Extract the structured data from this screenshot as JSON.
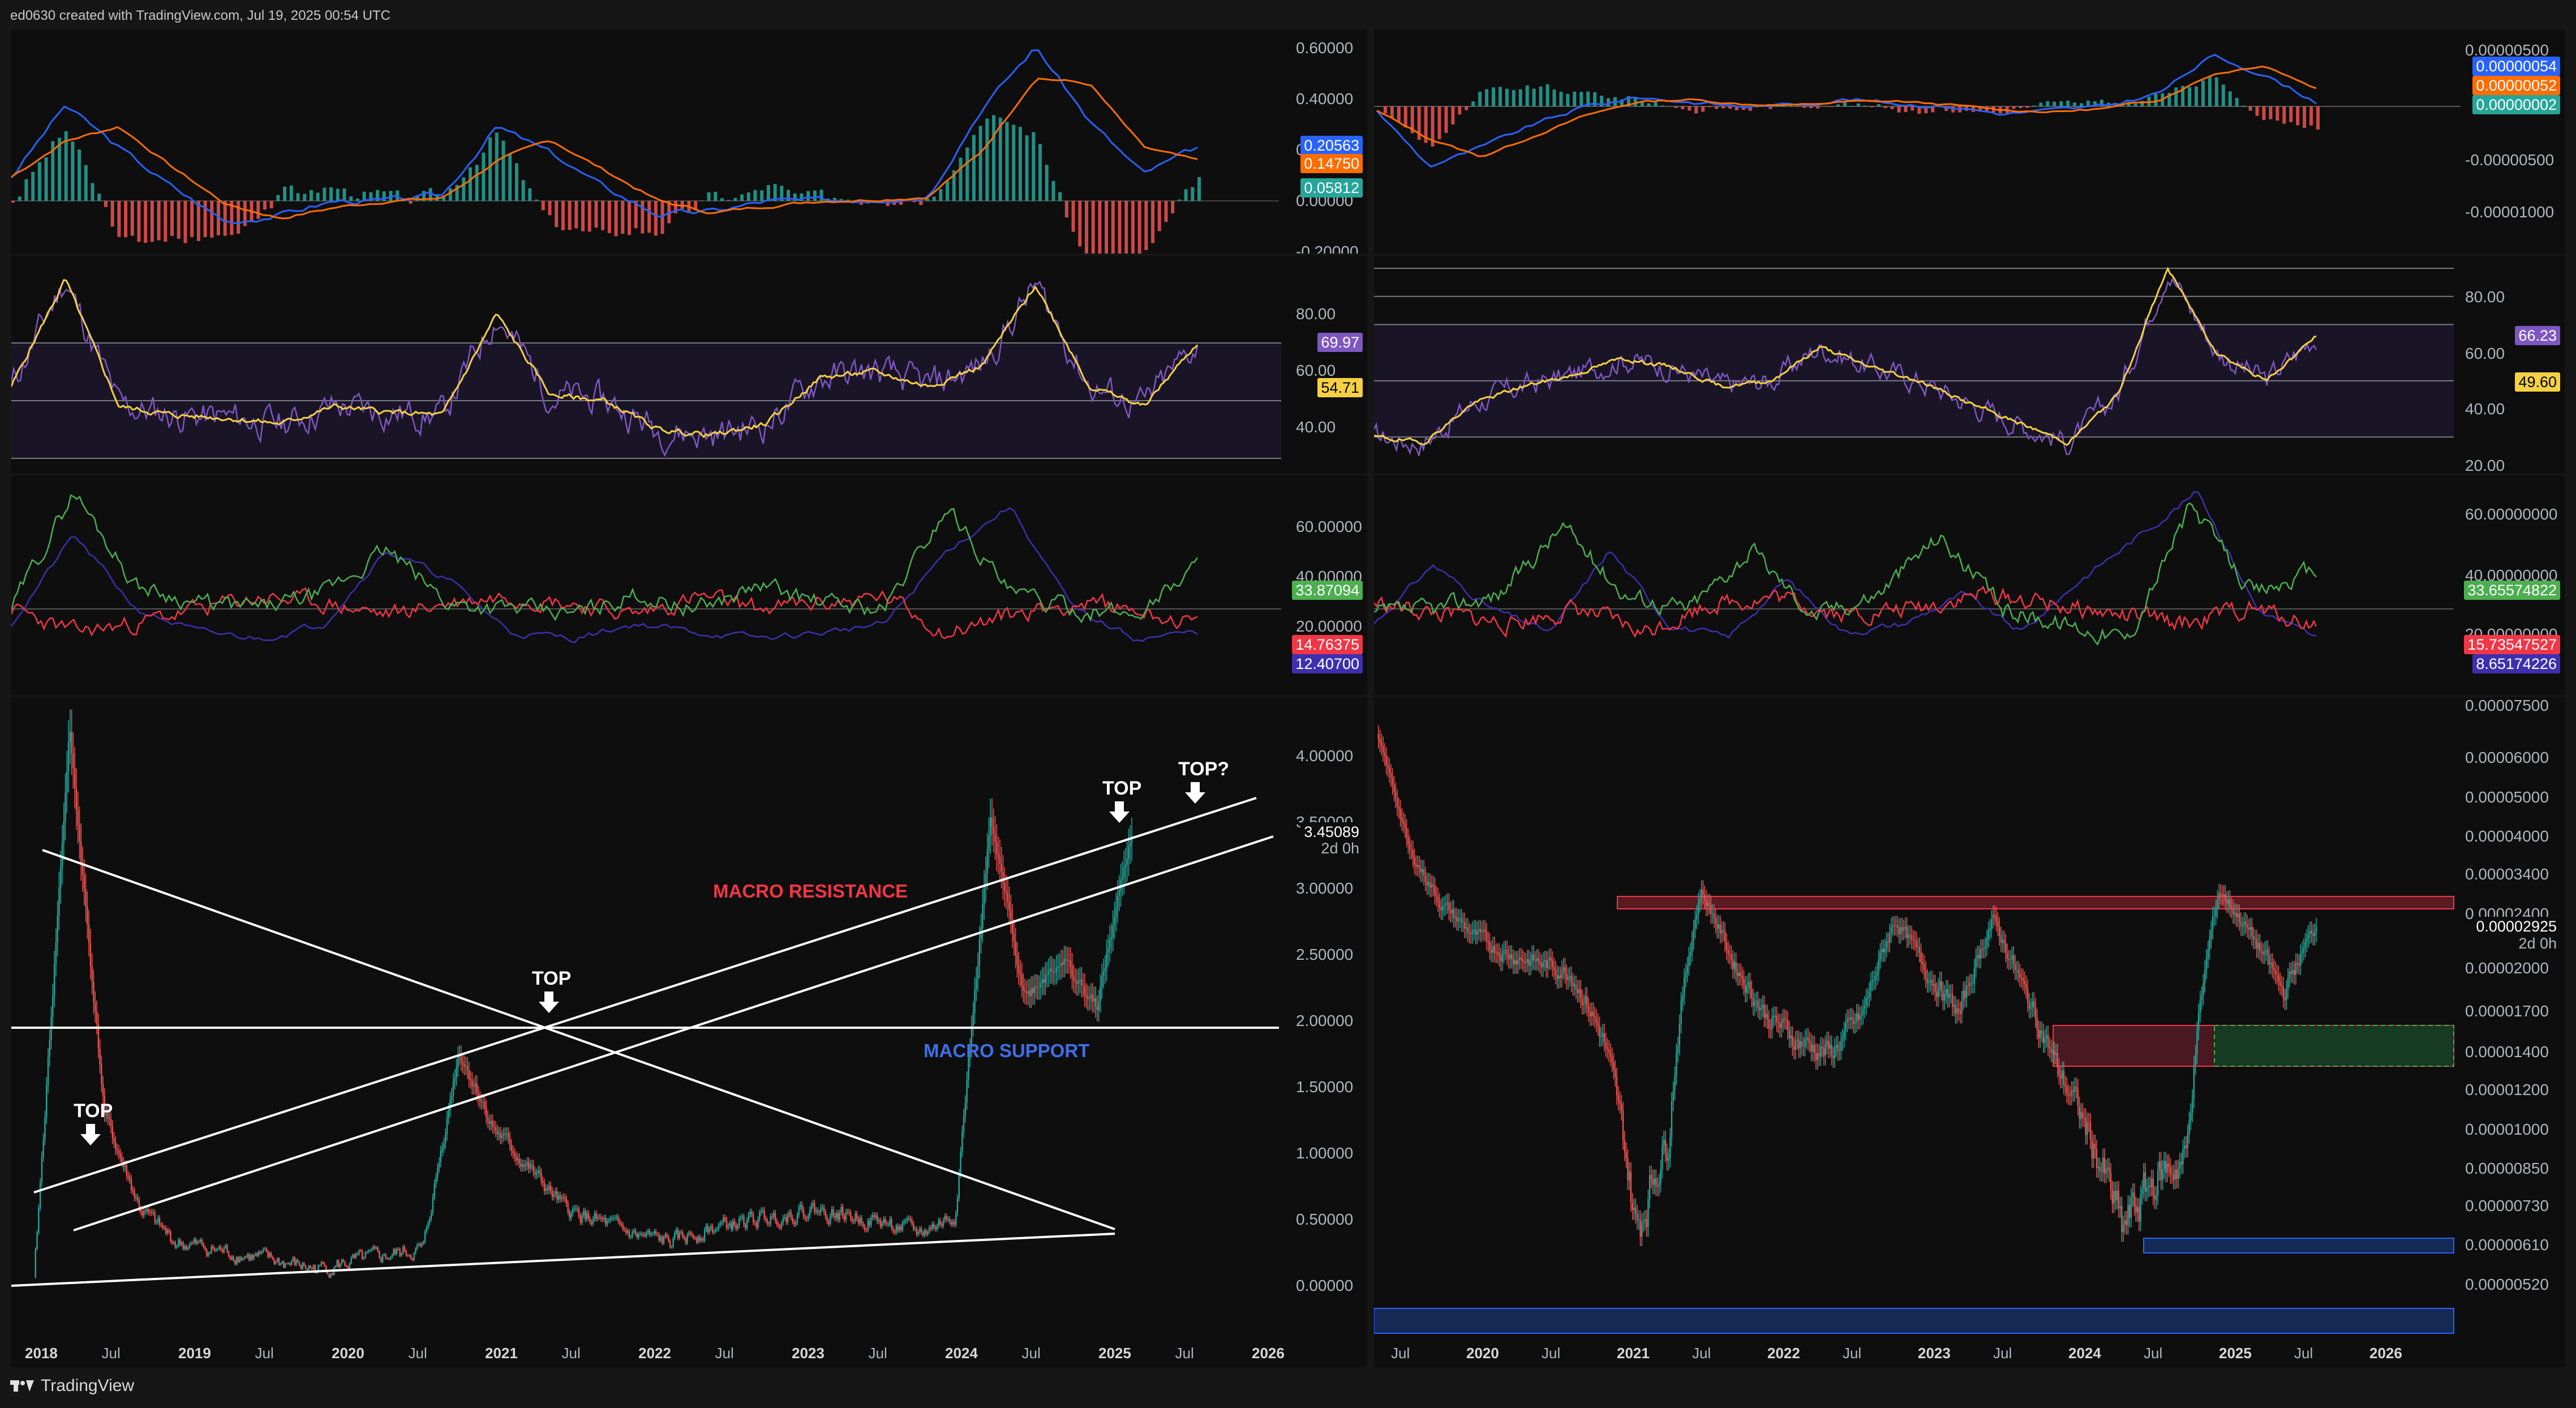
{
  "header": {
    "text": "ed0630 created with TradingView.com, Jul 19, 2025 00:54 UTC"
  },
  "footer": {
    "brand": "TradingView",
    "logo_icon": "tradingview-logo-icon"
  },
  "colors": {
    "bg": "#0e0e0e",
    "up": "#26a69a",
    "down": "#ef5350",
    "macd": "#2962ff",
    "signal": "#ff6d00",
    "rsi": "#7e57c2",
    "rsi_ma": "#f5d142",
    "plus_di": "#4caf50",
    "minus_di": "#f23645",
    "adx": "#3f2fb0"
  },
  "left": {
    "macd": {
      "ticks": [
        "0.60000",
        "0.40000",
        "0.20000",
        "0.00000",
        "-0.20000"
      ],
      "badges": {
        "macd": "0.20563",
        "signal": "0.14750",
        "hist": "0.05812"
      }
    },
    "rsi": {
      "ticks": [
        "80.00",
        "60.00",
        "40.00"
      ],
      "badges": {
        "rsi": "69.97",
        "ma": "54.71"
      }
    },
    "dmi": {
      "ticks": [
        "60.00000",
        "40.00000",
        "20.00000"
      ],
      "badges": {
        "plus": "33.87094",
        "minus": "14.76375",
        "adx": "12.40700"
      }
    },
    "price": {
      "ticks": [
        "4.00000",
        "3.50000",
        "3.00000",
        "2.50000",
        "2.00000",
        "1.50000",
        "1.00000",
        "0.50000",
        "0.00000"
      ],
      "last_value": "3.45089",
      "last_countdown": "2d 0h",
      "annotations": {
        "top1": "TOP",
        "top2": "TOP",
        "top3": "TOP",
        "top4": "TOP?",
        "resistance": "MACRO RESISTANCE",
        "support": "MACRO SUPPORT"
      },
      "xaxis": [
        {
          "label": "2018",
          "bold": true
        },
        {
          "label": "Jul",
          "bold": false
        },
        {
          "label": "2019",
          "bold": true
        },
        {
          "label": "Jul",
          "bold": false
        },
        {
          "label": "2020",
          "bold": true
        },
        {
          "label": "Jul",
          "bold": false
        },
        {
          "label": "2021",
          "bold": true
        },
        {
          "label": "Jul",
          "bold": false
        },
        {
          "label": "2022",
          "bold": true
        },
        {
          "label": "Jul",
          "bold": false
        },
        {
          "label": "2023",
          "bold": true
        },
        {
          "label": "Jul",
          "bold": false
        },
        {
          "label": "2024",
          "bold": true
        },
        {
          "label": "Jul",
          "bold": false
        },
        {
          "label": "2025",
          "bold": true
        },
        {
          "label": "Jul",
          "bold": false
        },
        {
          "label": "2026",
          "bold": true
        }
      ]
    }
  },
  "right": {
    "macd": {
      "ticks": [
        "0.00000500",
        "-0.00000500",
        "-0.00001000"
      ],
      "badges": {
        "macd": "0.00000054",
        "signal": "0.00000052",
        "hist": "0.00000002"
      }
    },
    "rsi": {
      "ticks": [
        "80.00",
        "60.00",
        "40.00",
        "20.00"
      ],
      "badges": {
        "rsi": "66.23",
        "ma": "49.60"
      }
    },
    "dmi": {
      "ticks": [
        "60.00000000",
        "40.00000000",
        "20.00000000"
      ],
      "badges": {
        "plus": "33.65574822",
        "minus": "15.73547527",
        "adx": "8.65174226"
      }
    },
    "price": {
      "ticks": [
        "0.00007500",
        "0.00006000",
        "0.00005000",
        "0.00004000",
        "0.00003400",
        "0.00002400",
        "0.00002000",
        "0.00001700",
        "0.00001400",
        "0.00001200",
        "0.00001000",
        "0.00000850",
        "0.00000730",
        "0.00000610",
        "0.00000520"
      ],
      "last_value": "0.00002925",
      "last_countdown": "2d 0h",
      "xaxis": [
        {
          "label": "Jul",
          "bold": false
        },
        {
          "label": "2020",
          "bold": true
        },
        {
          "label": "Jul",
          "bold": false
        },
        {
          "label": "2021",
          "bold": true
        },
        {
          "label": "Jul",
          "bold": false
        },
        {
          "label": "2022",
          "bold": true
        },
        {
          "label": "Jul",
          "bold": false
        },
        {
          "label": "2023",
          "bold": true
        },
        {
          "label": "Jul",
          "bold": false
        },
        {
          "label": "2024",
          "bold": true
        },
        {
          "label": "Jul",
          "bold": false
        },
        {
          "label": "2025",
          "bold": true
        },
        {
          "label": "Jul",
          "bold": false
        },
        {
          "label": "2026",
          "bold": true
        }
      ]
    }
  },
  "chart_data": [
    {
      "type": "line",
      "title": "",
      "series": [
        {
          "name": "",
          "values": [
            0.09,
            0.35,
            0.1,
            -0.1,
            0.0,
            0.32,
            0.04,
            -0.12,
            0.0,
            0.0,
            0.02,
            0.58,
            0.45,
            0.2
          ]
        }
      ],
      "ylim": [
        -0.2,
        0.65
      ]
    },
    {
      "type": "line",
      "title": "",
      "series": [
        {
          "name": "",
          "values": [
            55,
            92,
            45,
            42,
            48,
            80,
            50,
            38,
            55,
            60,
            88,
            50,
            70
          ]
        }
      ],
      "ylim": [
        30,
        95
      ]
    },
    {
      "type": "line",
      "title": "",
      "x": [
        "2018",
        "2019",
        "2020",
        "2021",
        "2022",
        "2023",
        "2024",
        "2025",
        "2026"
      ],
      "series": [
        {
          "name": "",
          "values": [
            0.05,
            4.2,
            0.35,
            0.15,
            0.3,
            1.8,
            0.5,
            0.42,
            0.55,
            0.6,
            3.5,
            2.1,
            3.45
          ]
        }
      ],
      "ylim": [
        -0.1,
        4.3
      ]
    },
    {
      "type": "line",
      "title": "",
      "series": [
        {
          "name": "",
          "values": [
            6.5e-05,
            3.5e-05,
            2.8e-05,
            1.8e-05,
            8e-06,
            3.4e-05,
            2.5e-05,
            2e-05,
            3e-05,
            1.8e-05,
            8e-06,
            3.4e-05,
            2.1e-05,
            2.925e-05
          ]
        }
      ],
      "ylim": [
        5.2e-06,
        7.5e-05
      ]
    }
  ]
}
